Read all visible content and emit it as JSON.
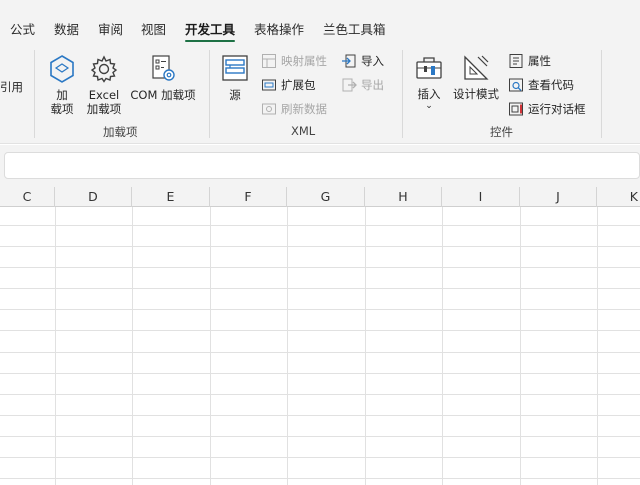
{
  "menu": {
    "tabs": [
      {
        "label": "公式"
      },
      {
        "label": "数据"
      },
      {
        "label": "审阅"
      },
      {
        "label": "视图"
      },
      {
        "label": "开发工具",
        "active": true
      },
      {
        "label": "表格操作"
      },
      {
        "label": "兰色工具箱"
      }
    ]
  },
  "ribbon": {
    "partial_left_label": "引用",
    "addins": {
      "group_label": "加载项",
      "addin_line1": "加",
      "addin_line2": "载项",
      "excel_line1": "Excel",
      "excel_line2": "加载项",
      "com_label": "COM 加载项"
    },
    "xml": {
      "group_label": "XML",
      "source_label": "源",
      "map_properties": "映射属性",
      "expansion_packs": "扩展包",
      "refresh_data": "刷新数据",
      "import": "导入",
      "export": "导出"
    },
    "controls": {
      "group_label": "控件",
      "insert_label": "插入",
      "design_mode": "设计模式",
      "properties": "属性",
      "view_code": "查看代码",
      "run_dialog": "运行对话框"
    }
  },
  "formula_bar": {
    "value": ""
  },
  "grid": {
    "columns": [
      "C",
      "D",
      "E",
      "F",
      "G",
      "H",
      "I",
      "J",
      "K"
    ]
  },
  "colors": {
    "accent": "#1e7145",
    "icon_blue": "#2b78c4",
    "icon_red": "#d13438"
  },
  "icons": {
    "addin": "hexagon-cube-icon",
    "excel_addin": "gear-icon",
    "com_addin": "list-gear-icon",
    "source": "xml-source-icon",
    "map_properties": "map-properties-icon",
    "expansion_packs": "expansion-pack-icon",
    "refresh_data": "refresh-data-icon",
    "import": "import-icon",
    "export": "export-icon",
    "insert": "toolbox-icon",
    "design_mode": "ruler-triangle-icon",
    "properties": "properties-icon",
    "view_code": "view-code-icon",
    "run_dialog": "run-dialog-icon"
  }
}
